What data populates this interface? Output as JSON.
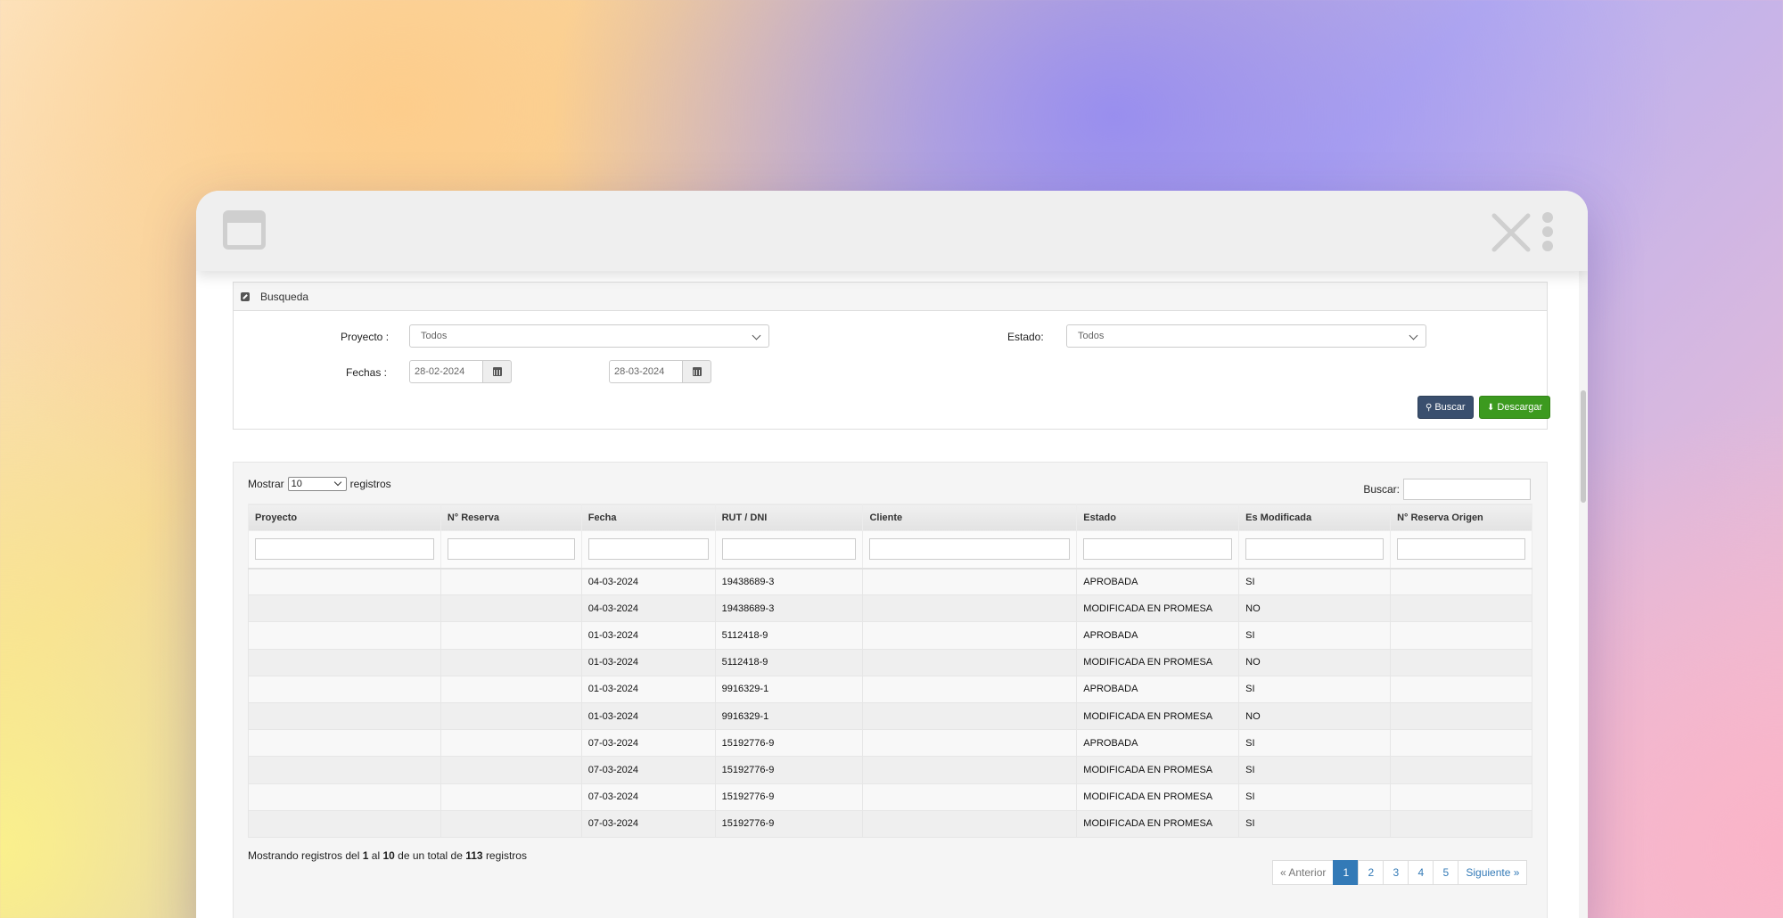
{
  "search_panel": {
    "title": "Busqueda",
    "proyecto_label": "Proyecto :",
    "proyecto_value": "Todos",
    "estado_label": "Estado:",
    "estado_value": "Todos",
    "fechas_label": "Fechas :",
    "fecha_desde": "28-02-2024",
    "fecha_hasta": "28-03-2024",
    "buscar_button": "Buscar",
    "descargar_button": "Descargar"
  },
  "table": {
    "show_prefix": "Mostrar",
    "show_value": "10",
    "show_suffix": "registros",
    "search_label": "Buscar:",
    "columns": [
      "Proyecto",
      "N° Reserva",
      "Fecha",
      "RUT / DNI",
      "Cliente",
      "Estado",
      "Es Modificada",
      "N° Reserva Origen"
    ],
    "rows": [
      {
        "proyecto": "",
        "reserva": "",
        "fecha": "04-03-2024",
        "rut": "19438689-3",
        "cliente": "",
        "estado": "APROBADA",
        "modificada": "SI",
        "origen": ""
      },
      {
        "proyecto": "",
        "reserva": "",
        "fecha": "04-03-2024",
        "rut": "19438689-3",
        "cliente": "",
        "estado": "MODIFICADA EN PROMESA",
        "modificada": "NO",
        "origen": ""
      },
      {
        "proyecto": "",
        "reserva": "",
        "fecha": "01-03-2024",
        "rut": "5112418-9",
        "cliente": "",
        "estado": "APROBADA",
        "modificada": "SI",
        "origen": ""
      },
      {
        "proyecto": "",
        "reserva": "",
        "fecha": "01-03-2024",
        "rut": "5112418-9",
        "cliente": "",
        "estado": "MODIFICADA EN PROMESA",
        "modificada": "NO",
        "origen": ""
      },
      {
        "proyecto": "",
        "reserva": "",
        "fecha": "01-03-2024",
        "rut": "9916329-1",
        "cliente": "",
        "estado": "APROBADA",
        "modificada": "SI",
        "origen": ""
      },
      {
        "proyecto": "",
        "reserva": "",
        "fecha": "01-03-2024",
        "rut": "9916329-1",
        "cliente": "",
        "estado": "MODIFICADA EN PROMESA",
        "modificada": "NO",
        "origen": ""
      },
      {
        "proyecto": "",
        "reserva": "",
        "fecha": "07-03-2024",
        "rut": "15192776-9",
        "cliente": "",
        "estado": "APROBADA",
        "modificada": "SI",
        "origen": ""
      },
      {
        "proyecto": "",
        "reserva": "",
        "fecha": "07-03-2024",
        "rut": "15192776-9",
        "cliente": "",
        "estado": "MODIFICADA EN PROMESA",
        "modificada": "SI",
        "origen": ""
      },
      {
        "proyecto": "",
        "reserva": "",
        "fecha": "07-03-2024",
        "rut": "15192776-9",
        "cliente": "",
        "estado": "MODIFICADA EN PROMESA",
        "modificada": "SI",
        "origen": ""
      },
      {
        "proyecto": "",
        "reserva": "",
        "fecha": "07-03-2024",
        "rut": "15192776-9",
        "cliente": "",
        "estado": "MODIFICADA EN PROMESA",
        "modificada": "SI",
        "origen": ""
      }
    ],
    "info": {
      "prefix": "Mostrando registros del",
      "from": "1",
      "mid1": "al",
      "to": "10",
      "mid2": "de un total de",
      "total": "113",
      "suffix": "registros"
    },
    "pagination": {
      "prev": "« Anterior",
      "pages": [
        "1",
        "2",
        "3",
        "4",
        "5"
      ],
      "active_page": "1",
      "next": "Siguiente »"
    }
  },
  "icons": {
    "window": "window-icon",
    "close": "close-icon",
    "menu": "kebab-menu-icon",
    "edit": "edit-icon",
    "calendar": "calendar-icon",
    "search": "search-icon",
    "download": "download-icon",
    "chevron": "chevron-down-icon"
  },
  "colors": {
    "buscar_button": "#3a4f6e",
    "descargar_button": "#3c9a1f",
    "active_page": "#337ab7"
  }
}
